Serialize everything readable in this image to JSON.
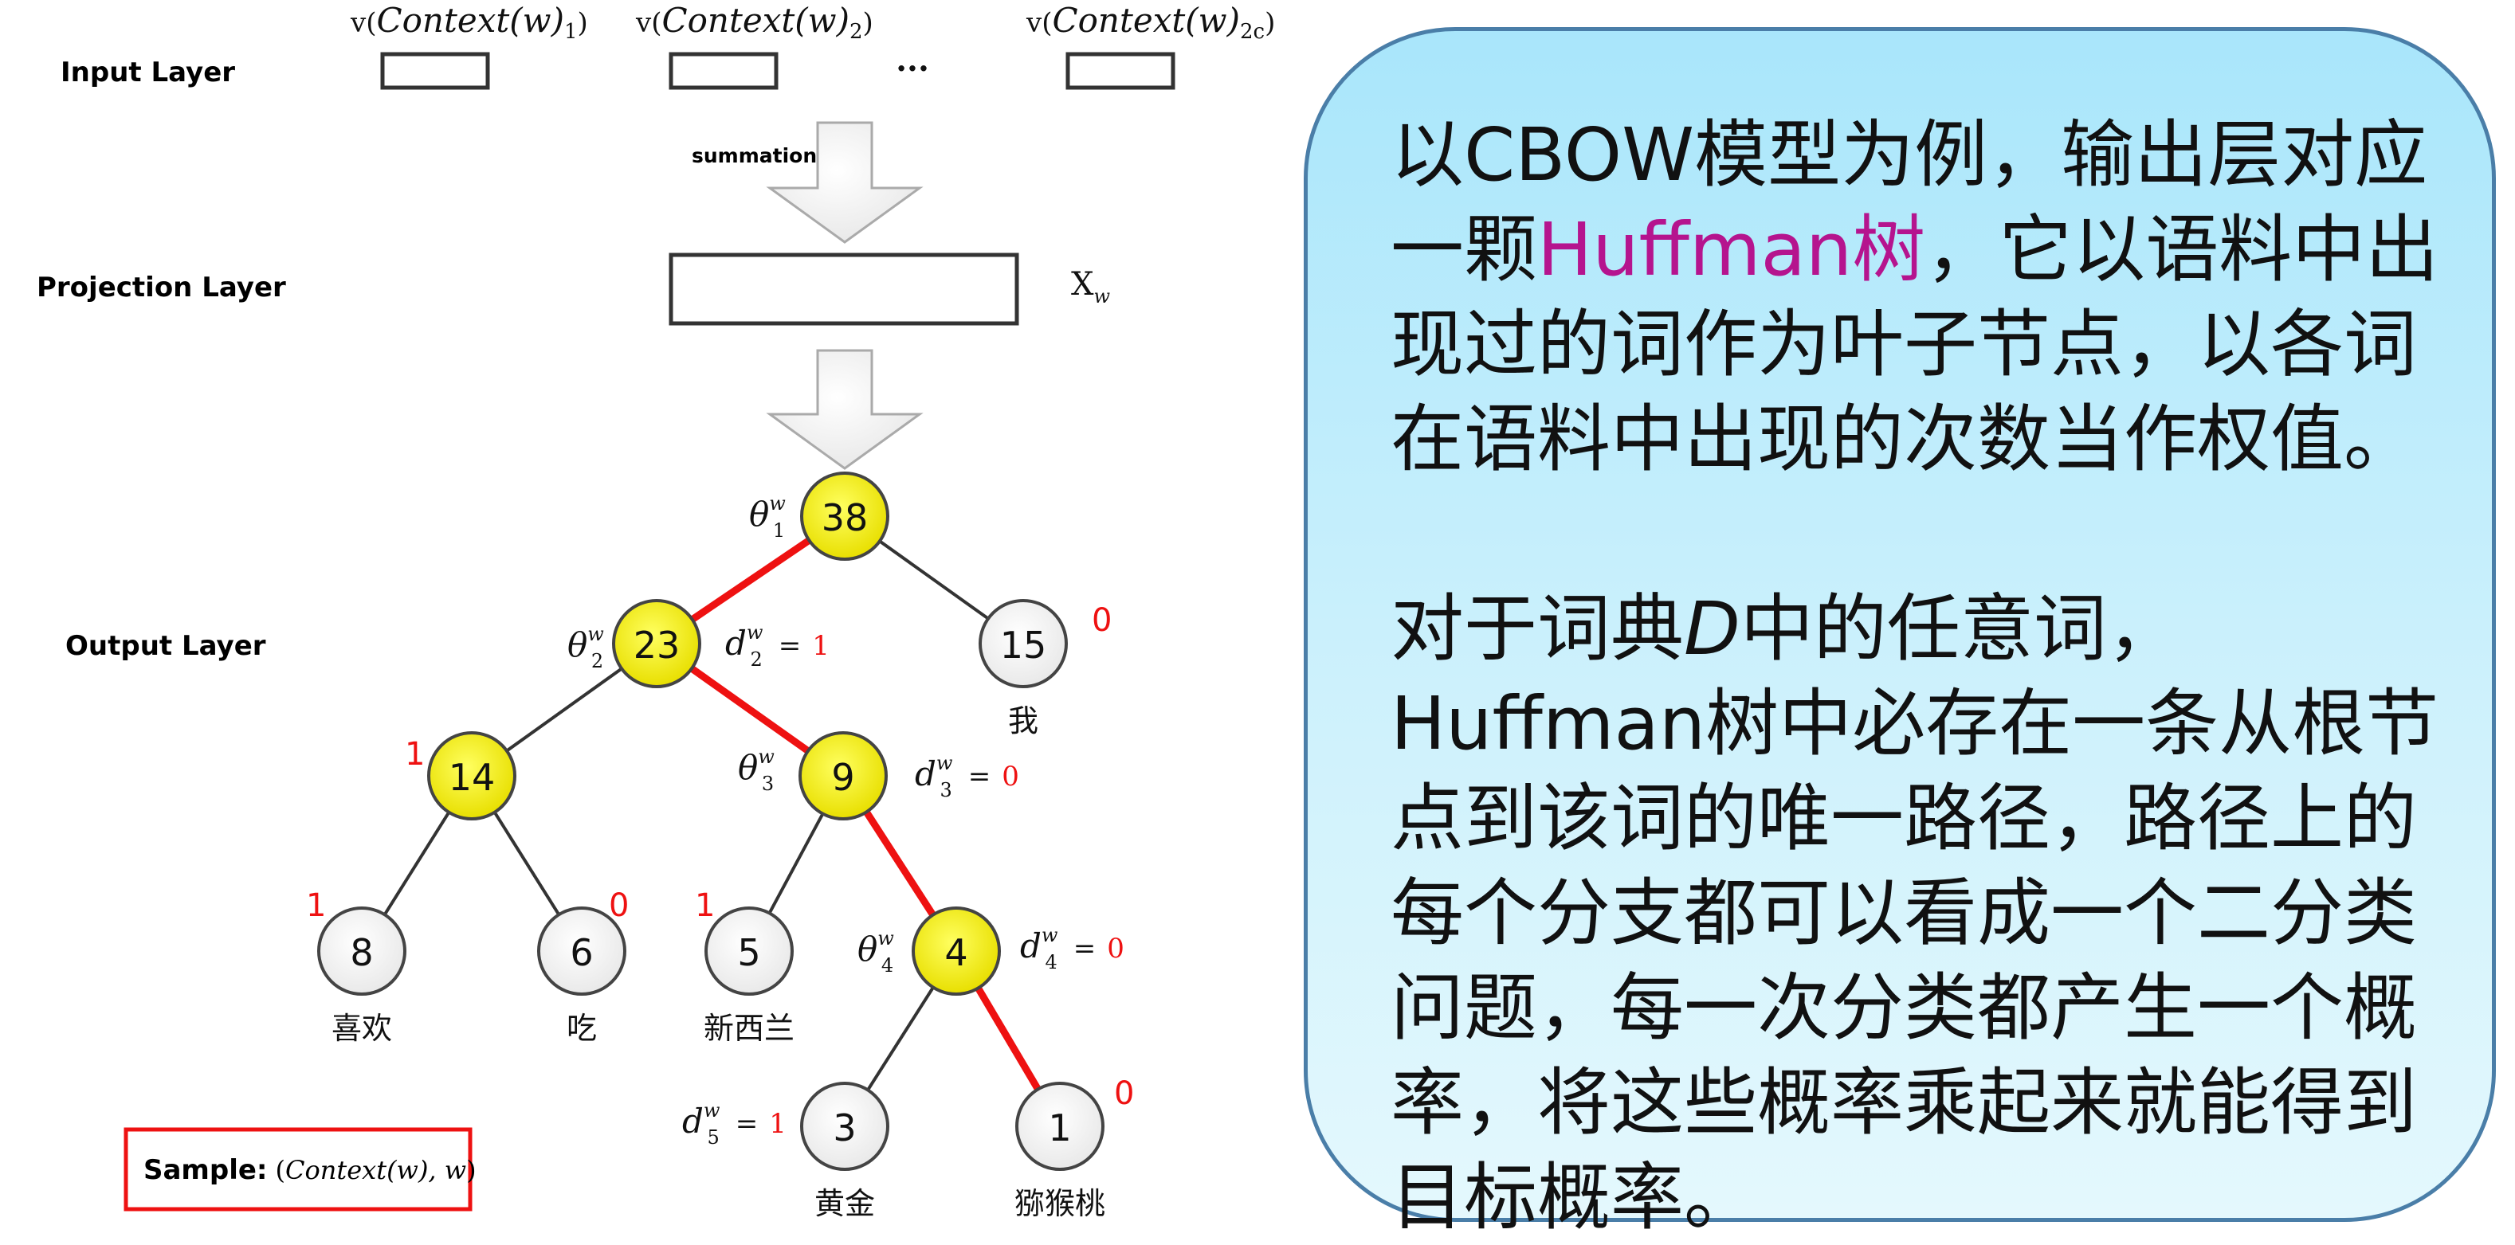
{
  "layers": {
    "input": "Input Layer",
    "projection": "Projection Layer",
    "output": "Output Layer"
  },
  "inputs": [
    {
      "prefix": "v(",
      "name": "Context",
      "arg": "(w)",
      "sub": "1",
      "suffix": ")"
    },
    {
      "prefix": "v(",
      "name": "Context",
      "arg": "(w)",
      "sub": "2",
      "suffix": ")"
    },
    {
      "prefix": "v(",
      "name": "Context",
      "arg": "(w)",
      "sub": "2c",
      "suffix": ")"
    }
  ],
  "ellipsis": "···",
  "summation_label": "summation",
  "projection_symbol": {
    "base": "X",
    "sub": "w"
  },
  "tree": {
    "nodes": [
      {
        "id": "n38",
        "value": "38",
        "highlight": true
      },
      {
        "id": "n23",
        "value": "23",
        "highlight": true
      },
      {
        "id": "n15",
        "value": "15",
        "highlight": false,
        "word": "我"
      },
      {
        "id": "n14",
        "value": "14",
        "highlight": true
      },
      {
        "id": "n9",
        "value": "9",
        "highlight": true
      },
      {
        "id": "n8",
        "value": "8",
        "highlight": false,
        "word": "喜欢"
      },
      {
        "id": "n6",
        "value": "6",
        "highlight": false,
        "word": "吃"
      },
      {
        "id": "n5",
        "value": "5",
        "highlight": false,
        "word": "新西兰"
      },
      {
        "id": "n4",
        "value": "4",
        "highlight": true
      },
      {
        "id": "n3",
        "value": "3",
        "highlight": false,
        "word": "黄金"
      },
      {
        "id": "n1",
        "value": "1",
        "highlight": false,
        "word": "猕猴桃"
      }
    ],
    "edges": [
      {
        "from": "n38",
        "to": "n23",
        "path": true
      },
      {
        "from": "n38",
        "to": "n15",
        "path": false
      },
      {
        "from": "n23",
        "to": "n14",
        "path": false
      },
      {
        "from": "n23",
        "to": "n9",
        "path": true
      },
      {
        "from": "n14",
        "to": "n8",
        "path": false
      },
      {
        "from": "n14",
        "to": "n6",
        "path": false
      },
      {
        "from": "n9",
        "to": "n5",
        "path": false
      },
      {
        "from": "n9",
        "to": "n4",
        "path": true
      },
      {
        "from": "n4",
        "to": "n3",
        "path": false
      },
      {
        "from": "n4",
        "to": "n1",
        "path": true
      }
    ],
    "branch_bits": [
      {
        "node": "n15",
        "bit": "0"
      },
      {
        "node": "n14",
        "bit": "1"
      },
      {
        "node": "n8",
        "bit": "1"
      },
      {
        "node": "n6",
        "bit": "0"
      },
      {
        "node": "n5",
        "bit": "1"
      },
      {
        "node": "n1",
        "bit": "0"
      }
    ],
    "thetas": [
      {
        "node": "n38",
        "sym": "θ",
        "sup": "w",
        "sub": "1"
      },
      {
        "node": "n23",
        "sym": "θ",
        "sup": "w",
        "sub": "2"
      },
      {
        "node": "n9",
        "sym": "θ",
        "sup": "w",
        "sub": "3"
      },
      {
        "node": "n4",
        "sym": "θ",
        "sup": "w",
        "sub": "4"
      }
    ],
    "codes": [
      {
        "node": "n23",
        "sym": "d",
        "sup": "w",
        "sub": "2",
        "eq": "=",
        "value": "1"
      },
      {
        "node": "n9",
        "sym": "d",
        "sup": "w",
        "sub": "3",
        "eq": "=",
        "value": "0"
      },
      {
        "node": "n4",
        "sym": "d",
        "sup": "w",
        "sub": "4",
        "eq": "=",
        "value": "0"
      },
      {
        "node": "n3",
        "sym": "d",
        "sup": "w",
        "sub": "5",
        "eq": "=",
        "value": "1"
      }
    ]
  },
  "sample": {
    "label": "Sample:",
    "expr_open": "(",
    "expr_name": "Context",
    "expr_arg": "(w), w",
    "expr_close": ")"
  },
  "colors": {
    "highlight_node": "#f2ec00",
    "plain_node": "#f7f7f7",
    "path_edge": "#ee1111",
    "edge": "#333333",
    "accent_text": "#b5148e",
    "callout_border": "#4a7ea8"
  },
  "callout": {
    "p1_a": "以CBOW模型为例，输出层对应一颗",
    "p1_hl": "Huffman树",
    "p1_b": "，它以语料中出现过的词作为叶子节点，以各词在语料中出现的次数当作权值。",
    "p2_a": "对于词典",
    "p2_it": "D",
    "p2_b": "中的任意词，Huffman树中必存在一条从根节点到该词的唯一路径，路径上的每个分支都可以看成一个二分类问题，每一次分类都产生一个概率，将这些概率乘起来就能得到目标概率。"
  }
}
